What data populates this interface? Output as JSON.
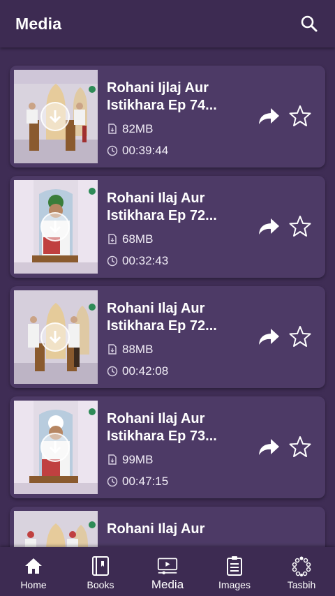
{
  "appbar": {
    "title": "Media",
    "search_icon": "search-icon"
  },
  "items": [
    {
      "title_line1": "Rohani Ijlaj Aur",
      "title_line2": "Istikhara Ep 74...",
      "size": "82MB",
      "duration": "00:39:44"
    },
    {
      "title_line1": "Rohani Ilaj Aur",
      "title_line2": "Istikhara Ep 72...",
      "size": "68MB",
      "duration": "00:32:43"
    },
    {
      "title_line1": "Rohani Ilaj Aur",
      "title_line2": "Istikhara Ep 72...",
      "size": "88MB",
      "duration": "00:42:08"
    },
    {
      "title_line1": "Rohani Ilaj Aur",
      "title_line2": "Istikhara Ep 73...",
      "size": "99MB",
      "duration": "00:47:15"
    },
    {
      "title_line1": "Rohani Ilaj Aur",
      "title_line2": "",
      "size": "",
      "duration": ""
    }
  ],
  "nav": [
    {
      "label": "Home",
      "icon": "home-icon"
    },
    {
      "label": "Books",
      "icon": "books-icon"
    },
    {
      "label": "Media",
      "icon": "media-icon",
      "active": true
    },
    {
      "label": "Images",
      "icon": "images-icon"
    },
    {
      "label": "Tasbih",
      "icon": "tasbih-icon"
    }
  ],
  "colors": {
    "background": "#3f2d55",
    "card": "#4d3a66",
    "bar": "#3d2b52"
  }
}
